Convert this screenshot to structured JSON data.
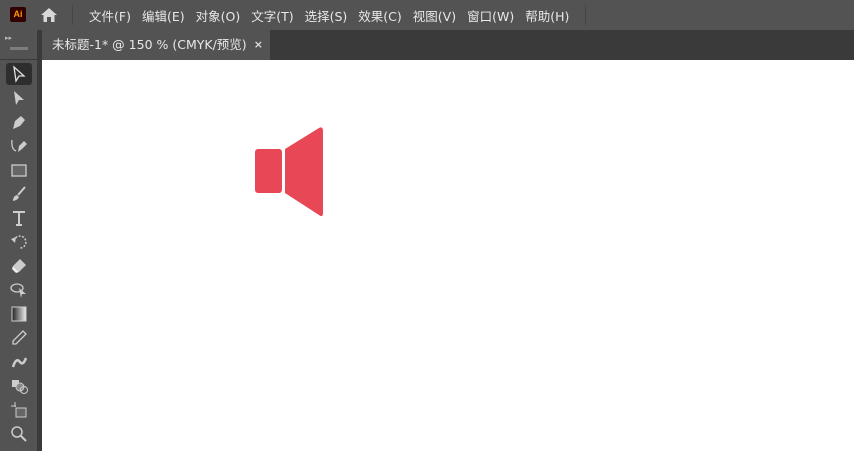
{
  "app": {
    "logo": "Ai"
  },
  "menu": [
    "文件(F)",
    "编辑(E)",
    "对象(O)",
    "文字(T)",
    "选择(S)",
    "效果(C)",
    "视图(V)",
    "窗口(W)",
    "帮助(H)"
  ],
  "tab": {
    "title": "未标题-1* @ 150 % (CMYK/预览)",
    "close": "×"
  },
  "tools": [
    "selection",
    "direct-selection",
    "pen",
    "curvature",
    "rectangle",
    "paintbrush",
    "type",
    "rotate",
    "eraser",
    "lasso-select",
    "gradient",
    "eyedropper",
    "puppet-warp",
    "shape-builder",
    "artboard",
    "zoom"
  ],
  "artwork": {
    "icon": "speaker-icon",
    "color": "#e84855"
  }
}
